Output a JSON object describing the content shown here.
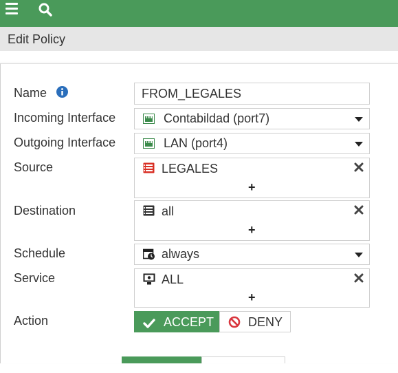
{
  "header": {
    "menu_icon": "hamburger-menu-icon",
    "search_icon": "search-icon",
    "page_title": "Edit Policy"
  },
  "colors": {
    "accent_green": "#4a9a5a",
    "title_bar_gray": "#e6e6e6",
    "source_red": "#d93025",
    "deny_red": "#d9363e"
  },
  "form": {
    "name_label": "Name",
    "name_value": "FROM_LEGALES",
    "incoming_label": "Incoming Interface",
    "incoming_value": "Contabildad (port7)",
    "outgoing_label": "Outgoing Interface",
    "outgoing_value": "LAN (port4)",
    "source_label": "Source",
    "source_value": "LEGALES",
    "destination_label": "Destination",
    "destination_value": "all",
    "schedule_label": "Schedule",
    "schedule_value": "always",
    "service_label": "Service",
    "service_value": "ALL",
    "action_label": "Action",
    "accept_label": "ACCEPT",
    "deny_label": "DENY",
    "plus_symbol": "+"
  }
}
